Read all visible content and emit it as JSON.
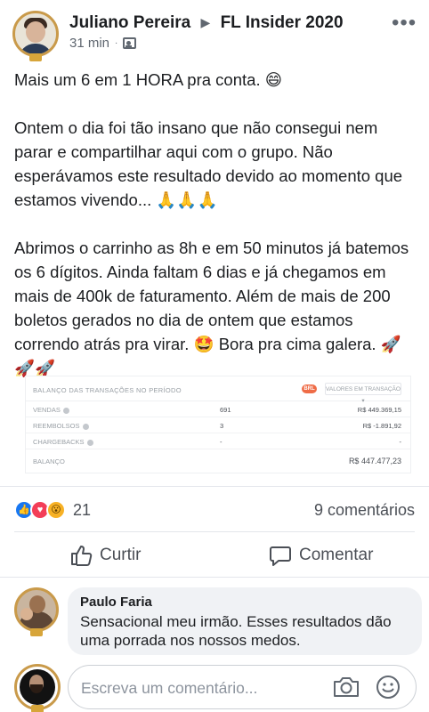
{
  "post": {
    "author": "Juliano Pereira",
    "group": "FL Insider 2020",
    "time": "31 min",
    "separator": "·",
    "more_icon": "•••",
    "paragraphs": [
      "Mais um 6 em 1 HORA pra conta. 😄",
      "Ontem o dia foi tão insano que não consegui nem parar e compartilhar aqui com o grupo. Não esperávamos este resultado devido ao momento que estamos vivendo... 🙏🙏🙏",
      "Abrimos o carrinho as 8h e em 50 minutos já batemos os 6 dígitos. Ainda faltam 6 dias e já chegamos em mais de 400k de faturamento. Além de mais de 200 boletos gerados no dia de ontem que estamos correndo atrás pra virar. 🤩 Bora pra cima galera. 🚀🚀🚀"
    ]
  },
  "report": {
    "title": "Balanço das transações no período",
    "currency_badge": "BRL",
    "select_value": "Valores em transação ▾",
    "rows": [
      {
        "label": "Vendas",
        "count": "691",
        "amount": "R$ 449.369,15"
      },
      {
        "label": "Reembolsos",
        "count": "3",
        "amount": "R$ -1.891,92"
      },
      {
        "label": "Chargebacks",
        "count": "-",
        "amount": "-"
      }
    ],
    "total": {
      "label": "Balanço",
      "amount": "R$ 447.477,23"
    }
  },
  "reactions": {
    "count": "21",
    "comments": "9 comentários",
    "like_glyph": "👍",
    "love_glyph": "♥",
    "wow_glyph": "😮"
  },
  "actions": {
    "like_label": "Curtir",
    "comment_label": "Comentar"
  },
  "comment": {
    "author": "Paulo Faria",
    "text": "Sensacional meu irmão. Esses resultados dão uma porrada nos nossos medos."
  },
  "composer": {
    "placeholder": "Escreva um comentário..."
  },
  "colors": {
    "accent_blue": "#1877f2",
    "love_red": "#f33e58",
    "wow_yellow": "#f7b125",
    "badge_orange": "#ef6c47",
    "avatar_ring_gold": "#c99a4a"
  }
}
